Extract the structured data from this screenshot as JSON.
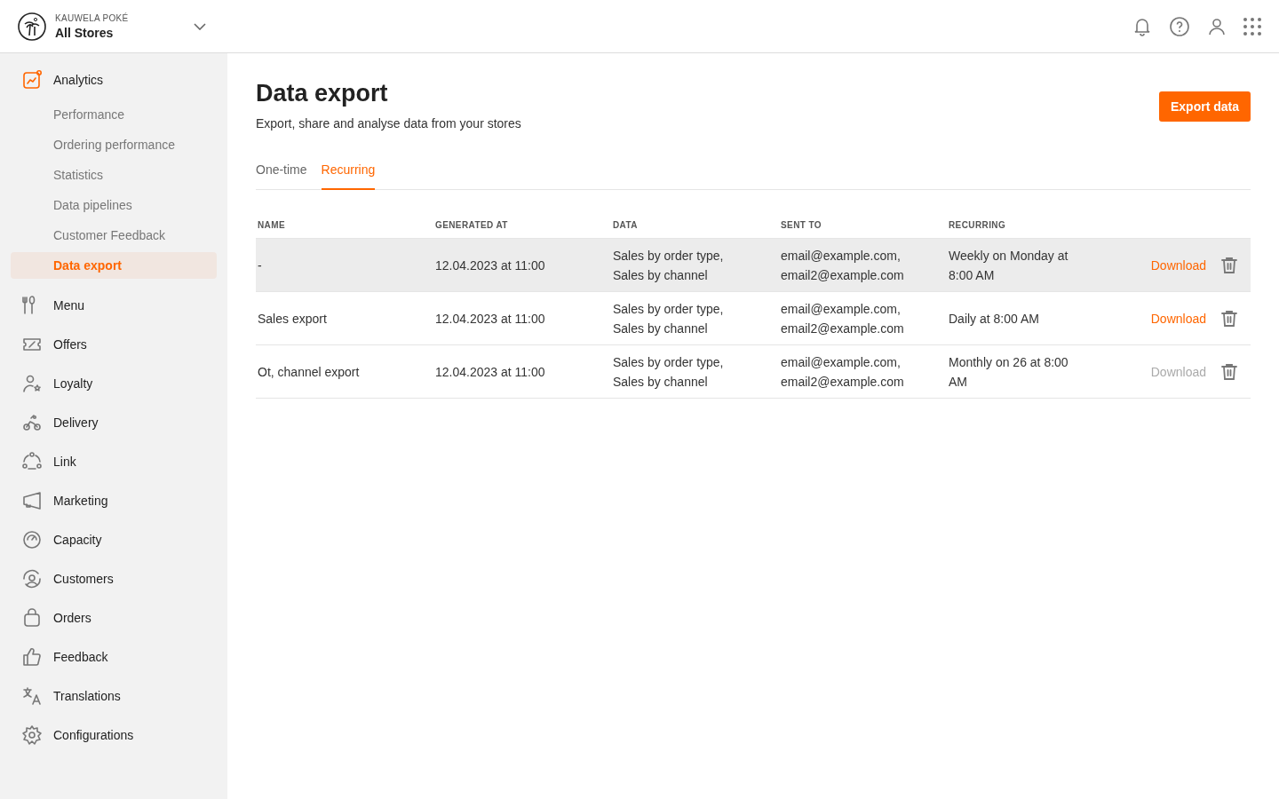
{
  "header": {
    "brand": "KAUWELA POKÉ",
    "store": "All Stores"
  },
  "sidebar": {
    "items": [
      {
        "label": "Analytics",
        "selected": true,
        "children": [
          {
            "label": "Performance",
            "selected": false
          },
          {
            "label": "Ordering performance",
            "selected": false
          },
          {
            "label": "Statistics",
            "selected": false
          },
          {
            "label": "Data pipelines",
            "selected": false
          },
          {
            "label": "Customer Feedback",
            "selected": false
          },
          {
            "label": "Data export",
            "selected": true
          }
        ]
      },
      {
        "label": "Menu",
        "selected": false
      },
      {
        "label": "Offers",
        "selected": false
      },
      {
        "label": "Loyalty",
        "selected": false
      },
      {
        "label": "Delivery",
        "selected": false
      },
      {
        "label": "Link",
        "selected": false
      },
      {
        "label": "Marketing",
        "selected": false
      },
      {
        "label": "Capacity",
        "selected": false
      },
      {
        "label": "Customers",
        "selected": false
      },
      {
        "label": "Orders",
        "selected": false
      },
      {
        "label": "Feedback",
        "selected": false
      },
      {
        "label": "Translations",
        "selected": false
      },
      {
        "label": "Configurations",
        "selected": false
      }
    ]
  },
  "page": {
    "title": "Data export",
    "subtitle": "Export, share and analyse data from your stores",
    "action": "Export data"
  },
  "tabs": [
    {
      "label": "One-time",
      "selected": false
    },
    {
      "label": "Recurring",
      "selected": true
    }
  ],
  "table": {
    "columns": [
      "NAME",
      "GENERATED AT",
      "DATA",
      "SENT TO",
      "RECURRING"
    ],
    "rows": [
      {
        "selected": true,
        "name": "-",
        "generated_at": "12.04.2023 at 11:00",
        "data": [
          "Sales by order type,",
          "Sales by channel"
        ],
        "sent_to": [
          "email@example.com,",
          "email2@example.com"
        ],
        "recurring": "Weekly on Monday at 8:00 AM",
        "download": "Download",
        "disabled": false
      },
      {
        "selected": false,
        "name": "Sales export",
        "generated_at": "12.04.2023 at 11:00",
        "data": [
          "Sales by order type,",
          "Sales by channel"
        ],
        "sent_to": [
          "email@example.com,",
          "email2@example.com"
        ],
        "recurring": "Daily at 8:00 AM",
        "download": "Download",
        "disabled": false
      },
      {
        "selected": false,
        "name": "Ot, channel export",
        "generated_at": "12.04.2023 at 11:00",
        "data": [
          "Sales by order type,",
          "Sales by channel"
        ],
        "sent_to": [
          "email@example.com,",
          "email2@example.com"
        ],
        "recurring": "Monthly on 26 at 8:00 AM",
        "download": "Download",
        "disabled": true
      }
    ]
  }
}
